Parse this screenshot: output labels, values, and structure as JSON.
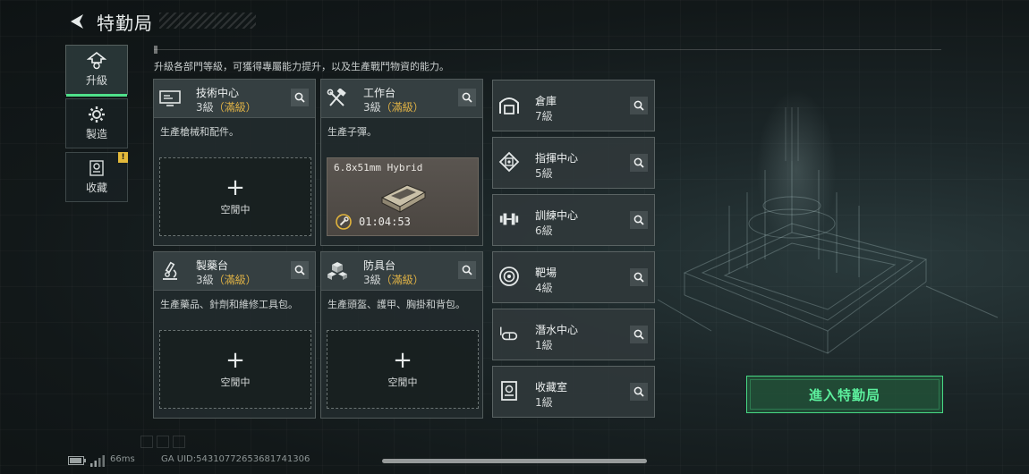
{
  "header": {
    "title": "特勤局",
    "back_icon": "back-arrow-icon"
  },
  "description": "升級各部門等級，可獲得專屬能力提升，以及生產戰鬥物資的能力。",
  "tabs": [
    {
      "label": "升級",
      "icon": "upgrade-icon",
      "active": true
    },
    {
      "label": "製造",
      "icon": "craft-gear-icon",
      "active": false
    },
    {
      "label": "收藏",
      "icon": "collection-icon",
      "active": false,
      "badge": "!"
    }
  ],
  "cards": {
    "tech_center": {
      "name": "技術中心",
      "level": "3級",
      "status": "（滿級）",
      "desc": "生產槍械和配件。",
      "slot_plus": "+",
      "slot_label": "空閒中"
    },
    "workbench": {
      "name": "工作台",
      "level": "3級",
      "status": "（滿級）",
      "desc": "生產子彈。",
      "item_name": "6.8x51mm Hybrid",
      "timer": "01:04:53"
    },
    "pharmacy": {
      "name": "製藥台",
      "level": "3級",
      "status": "（滿級）",
      "desc": "生產藥品、針劑和維修工具包。",
      "slot_plus": "+",
      "slot_label": "空閒中"
    },
    "armory": {
      "name": "防具台",
      "level": "3級",
      "status": "（滿級）",
      "desc": "生產頭盔、護甲、胸掛和背包。",
      "slot_plus": "+",
      "slot_label": "空閒中"
    }
  },
  "small_cards": [
    {
      "name": "倉庫",
      "level": "7級",
      "icon": "warehouse-icon"
    },
    {
      "name": "指揮中心",
      "level": "5級",
      "icon": "command-chip-icon"
    },
    {
      "name": "訓練中心",
      "level": "6級",
      "icon": "dumbbell-icon"
    },
    {
      "name": "靶場",
      "level": "4級",
      "icon": "target-icon"
    },
    {
      "name": "潛水中心",
      "level": "1級",
      "icon": "diving-goggles-icon"
    },
    {
      "name": "收藏室",
      "level": "1級",
      "icon": "collection-room-icon"
    }
  ],
  "enter_button": "進入特勤局",
  "footer": {
    "ping": "66ms",
    "uid": "GA UID:54310772653681741306"
  },
  "colors": {
    "accent_green": "#47d884",
    "maxed_gold": "#e0b245"
  }
}
